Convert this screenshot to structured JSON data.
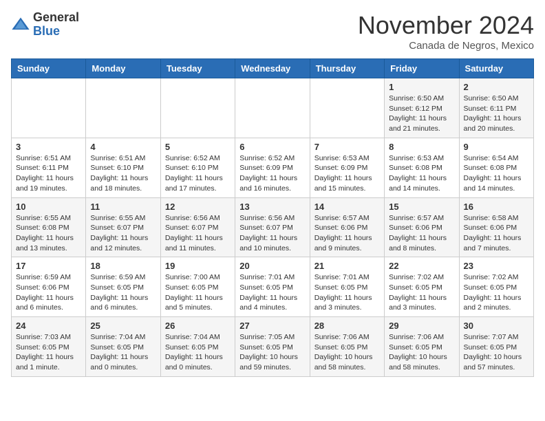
{
  "header": {
    "logo_general": "General",
    "logo_blue": "Blue",
    "month_title": "November 2024",
    "location": "Canada de Negros, Mexico"
  },
  "days_of_week": [
    "Sunday",
    "Monday",
    "Tuesday",
    "Wednesday",
    "Thursday",
    "Friday",
    "Saturday"
  ],
  "weeks": [
    [
      {
        "day": "",
        "info": ""
      },
      {
        "day": "",
        "info": ""
      },
      {
        "day": "",
        "info": ""
      },
      {
        "day": "",
        "info": ""
      },
      {
        "day": "",
        "info": ""
      },
      {
        "day": "1",
        "info": "Sunrise: 6:50 AM\nSunset: 6:12 PM\nDaylight: 11 hours\nand 21 minutes."
      },
      {
        "day": "2",
        "info": "Sunrise: 6:50 AM\nSunset: 6:11 PM\nDaylight: 11 hours\nand 20 minutes."
      }
    ],
    [
      {
        "day": "3",
        "info": "Sunrise: 6:51 AM\nSunset: 6:11 PM\nDaylight: 11 hours\nand 19 minutes."
      },
      {
        "day": "4",
        "info": "Sunrise: 6:51 AM\nSunset: 6:10 PM\nDaylight: 11 hours\nand 18 minutes."
      },
      {
        "day": "5",
        "info": "Sunrise: 6:52 AM\nSunset: 6:10 PM\nDaylight: 11 hours\nand 17 minutes."
      },
      {
        "day": "6",
        "info": "Sunrise: 6:52 AM\nSunset: 6:09 PM\nDaylight: 11 hours\nand 16 minutes."
      },
      {
        "day": "7",
        "info": "Sunrise: 6:53 AM\nSunset: 6:09 PM\nDaylight: 11 hours\nand 15 minutes."
      },
      {
        "day": "8",
        "info": "Sunrise: 6:53 AM\nSunset: 6:08 PM\nDaylight: 11 hours\nand 14 minutes."
      },
      {
        "day": "9",
        "info": "Sunrise: 6:54 AM\nSunset: 6:08 PM\nDaylight: 11 hours\nand 14 minutes."
      }
    ],
    [
      {
        "day": "10",
        "info": "Sunrise: 6:55 AM\nSunset: 6:08 PM\nDaylight: 11 hours\nand 13 minutes."
      },
      {
        "day": "11",
        "info": "Sunrise: 6:55 AM\nSunset: 6:07 PM\nDaylight: 11 hours\nand 12 minutes."
      },
      {
        "day": "12",
        "info": "Sunrise: 6:56 AM\nSunset: 6:07 PM\nDaylight: 11 hours\nand 11 minutes."
      },
      {
        "day": "13",
        "info": "Sunrise: 6:56 AM\nSunset: 6:07 PM\nDaylight: 11 hours\nand 10 minutes."
      },
      {
        "day": "14",
        "info": "Sunrise: 6:57 AM\nSunset: 6:06 PM\nDaylight: 11 hours\nand 9 minutes."
      },
      {
        "day": "15",
        "info": "Sunrise: 6:57 AM\nSunset: 6:06 PM\nDaylight: 11 hours\nand 8 minutes."
      },
      {
        "day": "16",
        "info": "Sunrise: 6:58 AM\nSunset: 6:06 PM\nDaylight: 11 hours\nand 7 minutes."
      }
    ],
    [
      {
        "day": "17",
        "info": "Sunrise: 6:59 AM\nSunset: 6:06 PM\nDaylight: 11 hours\nand 6 minutes."
      },
      {
        "day": "18",
        "info": "Sunrise: 6:59 AM\nSunset: 6:05 PM\nDaylight: 11 hours\nand 6 minutes."
      },
      {
        "day": "19",
        "info": "Sunrise: 7:00 AM\nSunset: 6:05 PM\nDaylight: 11 hours\nand 5 minutes."
      },
      {
        "day": "20",
        "info": "Sunrise: 7:01 AM\nSunset: 6:05 PM\nDaylight: 11 hours\nand 4 minutes."
      },
      {
        "day": "21",
        "info": "Sunrise: 7:01 AM\nSunset: 6:05 PM\nDaylight: 11 hours\nand 3 minutes."
      },
      {
        "day": "22",
        "info": "Sunrise: 7:02 AM\nSunset: 6:05 PM\nDaylight: 11 hours\nand 3 minutes."
      },
      {
        "day": "23",
        "info": "Sunrise: 7:02 AM\nSunset: 6:05 PM\nDaylight: 11 hours\nand 2 minutes."
      }
    ],
    [
      {
        "day": "24",
        "info": "Sunrise: 7:03 AM\nSunset: 6:05 PM\nDaylight: 11 hours\nand 1 minute."
      },
      {
        "day": "25",
        "info": "Sunrise: 7:04 AM\nSunset: 6:05 PM\nDaylight: 11 hours\nand 0 minutes."
      },
      {
        "day": "26",
        "info": "Sunrise: 7:04 AM\nSunset: 6:05 PM\nDaylight: 11 hours\nand 0 minutes."
      },
      {
        "day": "27",
        "info": "Sunrise: 7:05 AM\nSunset: 6:05 PM\nDaylight: 10 hours\nand 59 minutes."
      },
      {
        "day": "28",
        "info": "Sunrise: 7:06 AM\nSunset: 6:05 PM\nDaylight: 10 hours\nand 58 minutes."
      },
      {
        "day": "29",
        "info": "Sunrise: 7:06 AM\nSunset: 6:05 PM\nDaylight: 10 hours\nand 58 minutes."
      },
      {
        "day": "30",
        "info": "Sunrise: 7:07 AM\nSunset: 6:05 PM\nDaylight: 10 hours\nand 57 minutes."
      }
    ]
  ]
}
